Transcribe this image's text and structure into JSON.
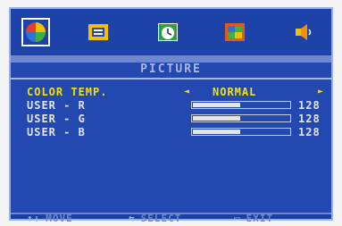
{
  "tabs": [
    {
      "id": "picture",
      "icon": "color-wheel-icon",
      "active": true
    },
    {
      "id": "osd",
      "icon": "osd-menu-icon",
      "active": false
    },
    {
      "id": "timer",
      "icon": "clock-icon",
      "active": false
    },
    {
      "id": "display",
      "icon": "monitor-icon",
      "active": false
    },
    {
      "id": "audio",
      "icon": "speaker-icon",
      "active": false
    }
  ],
  "panel": {
    "title": "PICTURE",
    "color_temp": {
      "label": "COLOR TEMP.",
      "value": "NORMAL",
      "left_arrow": "◄",
      "right_arrow": "►"
    },
    "sliders": [
      {
        "label": "USER - R",
        "value": "128",
        "level": 0.5
      },
      {
        "label": "USER - G",
        "value": "128",
        "level": 0.5
      },
      {
        "label": "USER - B",
        "value": "128",
        "level": 0.5
      }
    ]
  },
  "footer": {
    "move_icon": "↑↓",
    "move_label": "MOVE",
    "select_icon": "⇆",
    "select_label": "SELECT",
    "exit_icon": "▭",
    "exit_label": "EXIT"
  },
  "colors": {
    "background": "#1b3fa0",
    "highlight": "#f2e400",
    "text": "#e6e6e6",
    "muted": "#6f87cc"
  }
}
